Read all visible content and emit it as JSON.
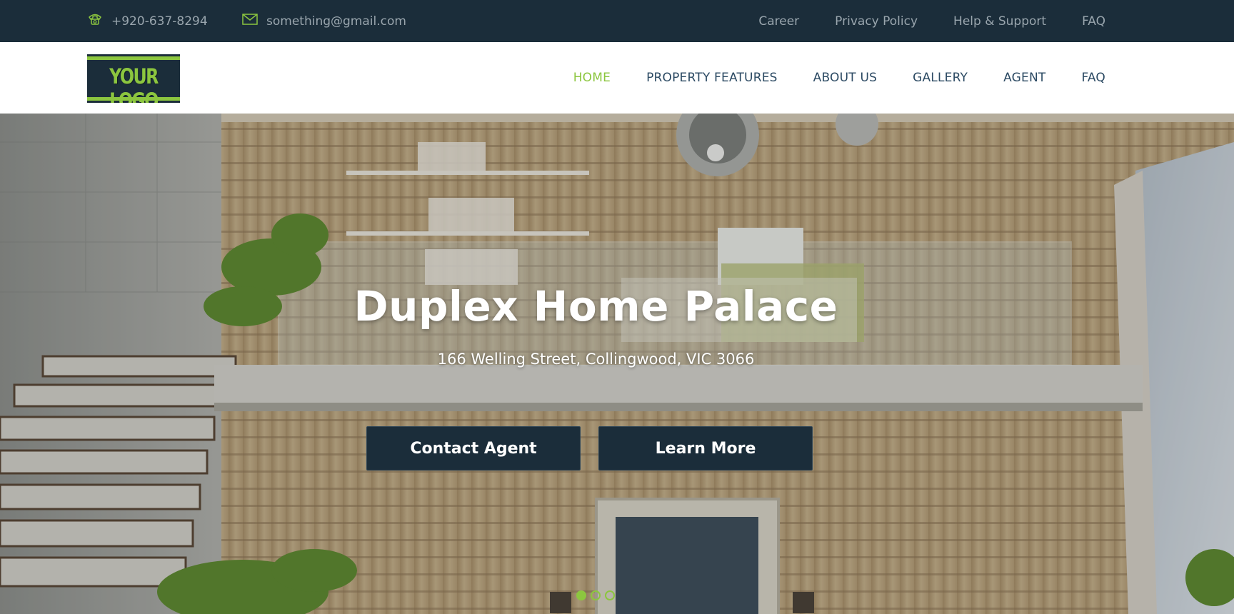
{
  "topbar": {
    "phone": "+920-637-8294",
    "email": "something@gmail.com",
    "links": [
      "Career",
      "Privacy Policy",
      "Help & Support",
      "FAQ"
    ]
  },
  "header": {
    "logo_text": "YOUR LOGO",
    "nav": [
      {
        "label": "HOME",
        "active": true
      },
      {
        "label": "PROPERTY FEATURES",
        "active": false
      },
      {
        "label": "ABOUT US",
        "active": false
      },
      {
        "label": "GALLERY",
        "active": false
      },
      {
        "label": "AGENT",
        "active": false
      },
      {
        "label": "FAQ",
        "active": false
      }
    ]
  },
  "hero": {
    "title": "Duplex Home Palace",
    "address": "166 Welling Street, Collingwood, VIC 3066",
    "buttons": {
      "contact": "Contact Agent",
      "learn": "Learn More"
    },
    "slides": 3,
    "active_slide": 1
  },
  "colors": {
    "dark": "#1b2d3a",
    "accent": "#8cc63f",
    "nav_text": "#2c4a63",
    "topbar_text": "#9aa6ae"
  },
  "icons": {
    "phone": "phone-icon",
    "email": "envelope-icon"
  }
}
